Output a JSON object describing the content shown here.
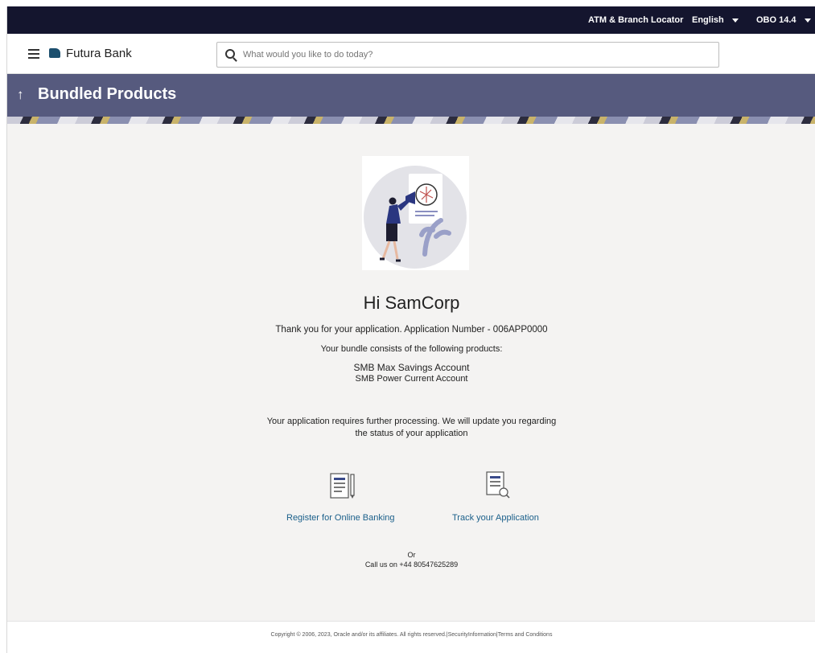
{
  "topbar": {
    "locator": "ATM & Branch Locator",
    "language": "English",
    "version": "OBO 14.4"
  },
  "header": {
    "brand": "Futura Bank",
    "search_placeholder": "What would you like to do today?"
  },
  "page": {
    "title": "Bundled Products"
  },
  "content": {
    "greeting": "Hi SamCorp",
    "thanks": "Thank you for your application. Application Number - 006APP0000",
    "bundle_intro": "Your bundle consists of the following products:",
    "products": [
      "SMB Max Savings Account",
      "SMB Power Current Account"
    ],
    "processing_line1": "Your application requires further processing. We will update you regarding",
    "processing_line2": "the status of your application",
    "register_link": "Register for Online Banking",
    "track_link": "Track your Application",
    "or": "Or",
    "call": "Call us on +44 80547625289"
  },
  "footer": {
    "copyright": "Copyright © 2006, 2023, Oracle and/or its affiliates. All rights reserved.|SecurityInformation|Terms and Conditions"
  },
  "colors": {
    "topbar": "#14152e",
    "banner": "#565a7e",
    "link": "#1a5f8a",
    "background": "#f4f3f2"
  }
}
